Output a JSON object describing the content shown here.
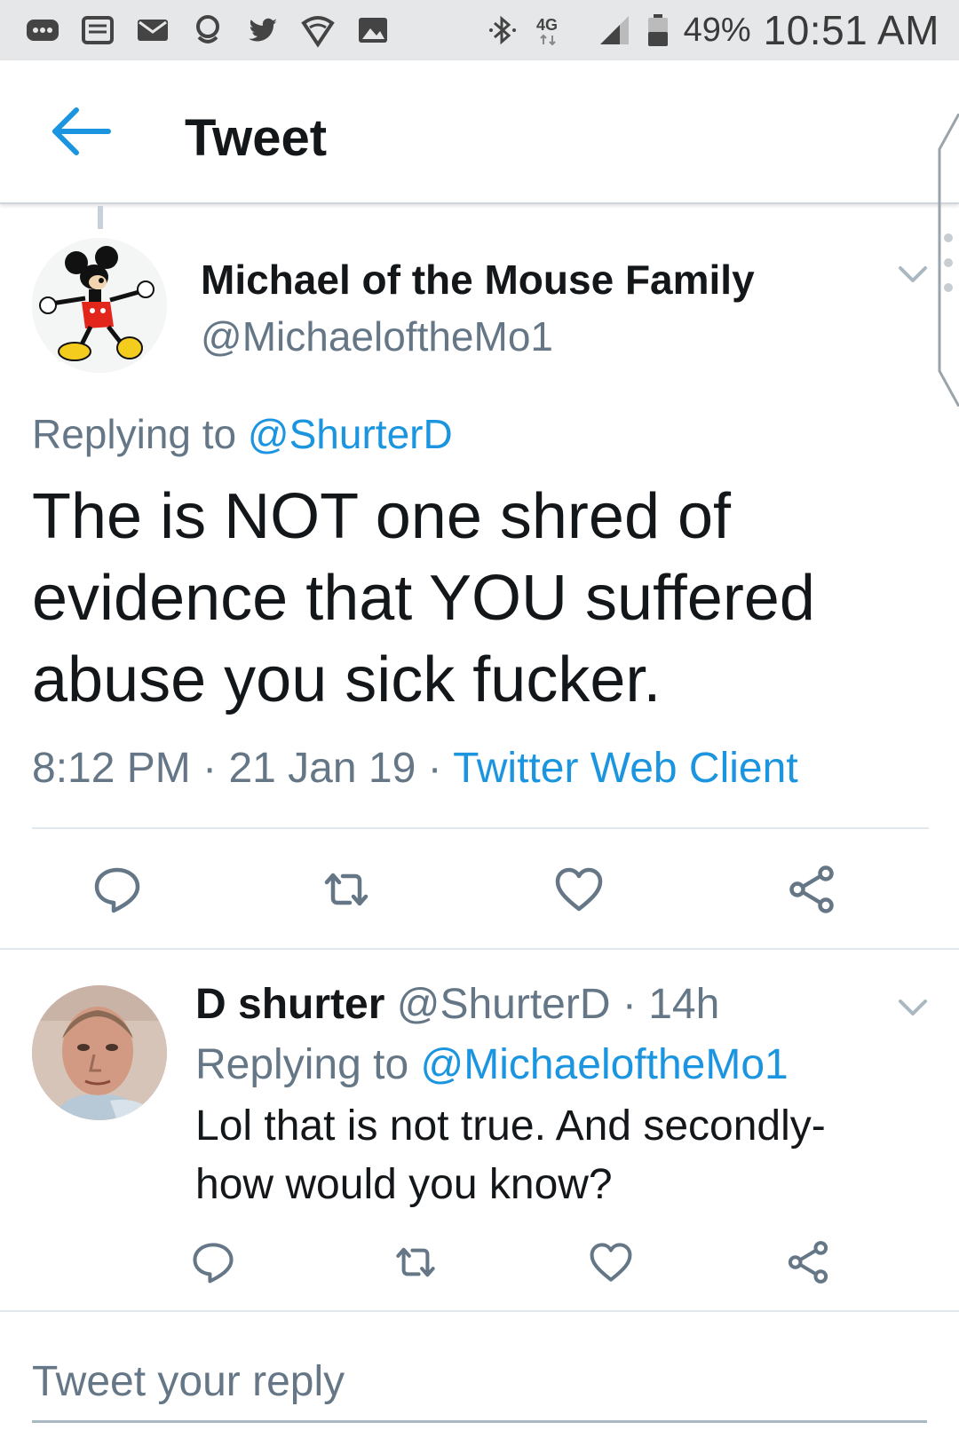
{
  "status_bar": {
    "battery_percent": "49%",
    "time": "10:51 AM",
    "network_label": "4G",
    "icons": [
      "more-icon",
      "message-icon",
      "mail-icon",
      "location-icon",
      "twitter-icon",
      "wifi-shield-icon",
      "image-icon",
      "bluetooth-icon",
      "lte-icon",
      "signal-icon",
      "battery-icon"
    ]
  },
  "header": {
    "title": "Tweet",
    "back_icon": "back-arrow-icon"
  },
  "tweet": {
    "author_name": "Michael of the Mouse Family",
    "author_handle": "@MichaeloftheMo1",
    "replying_prefix": "Replying to",
    "replying_to": "@ShurterD",
    "text": "The is NOT one shred of evidence that YOU suffered abuse you sick fucker.",
    "time": "8:12 PM",
    "separator": "·",
    "date": "21 Jan 19",
    "client": "Twitter Web Client",
    "actions": [
      "reply-icon",
      "retweet-icon",
      "like-icon",
      "share-icon"
    ]
  },
  "reply": {
    "author_name": "D shurter",
    "author_handle": "@ShurterD",
    "separator": "·",
    "age": "14h",
    "replying_prefix": "Replying to",
    "replying_to": "@MichaeloftheMo1",
    "text": "Lol that is not true. And secondly- how would you know?",
    "actions": [
      "reply-icon",
      "retweet-icon",
      "like-icon",
      "share-icon"
    ]
  },
  "compose": {
    "placeholder": "Tweet your reply"
  },
  "colors": {
    "accent": "#1b95e0",
    "secondary_text": "#657786",
    "primary_text": "#14171a",
    "divider": "#e1e8ed",
    "status_bar_bg": "#e6e7e8"
  }
}
